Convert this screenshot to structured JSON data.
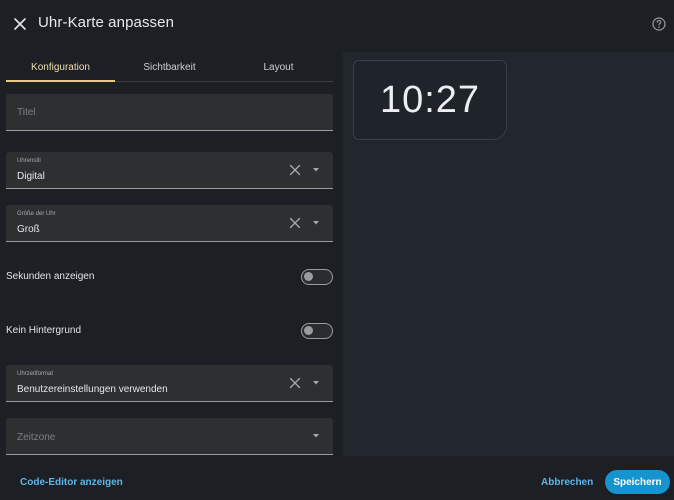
{
  "header": {
    "title": "Uhr-Karte anpassen"
  },
  "tabs": [
    {
      "label": "Konfiguration",
      "active": true
    },
    {
      "label": "Sichtbarkeit",
      "active": false
    },
    {
      "label": "Layout",
      "active": false
    }
  ],
  "form": {
    "title_field": {
      "placeholder": "Titel"
    },
    "clock_style": {
      "label": "Uhrenstil",
      "value": "Digital"
    },
    "clock_size": {
      "label": "Größe der Uhr",
      "value": "Groß"
    },
    "show_seconds": {
      "label": "Sekunden anzeigen",
      "on": false
    },
    "no_background": {
      "label": "Kein Hintergrund",
      "on": false
    },
    "time_format": {
      "label": "Uhrzeitformat",
      "value": "Benutzereinstellungen verwenden"
    },
    "timezone": {
      "placeholder": "Zeitzone"
    }
  },
  "preview": {
    "time": "10:27"
  },
  "footer": {
    "code_editor_label": "Code-Editor anzeigen",
    "cancel_label": "Abbrechen",
    "save_label": "Speichern"
  },
  "colors": {
    "accent": "#e9c97c",
    "link": "#5cb6ea",
    "primary_button": "#1594cf"
  }
}
